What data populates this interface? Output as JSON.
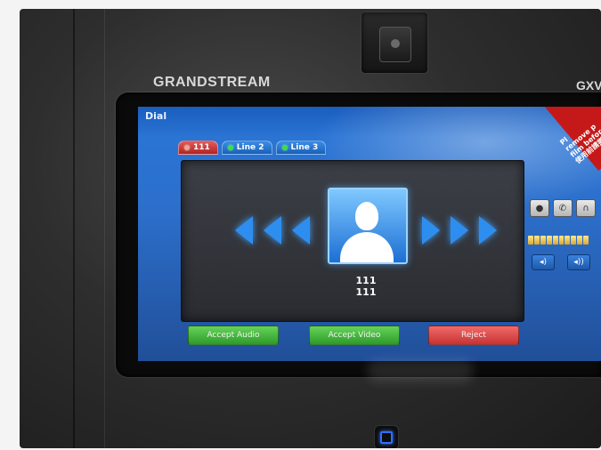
{
  "device": {
    "brand": "GRANDSTREAM",
    "model_partial": "GXV"
  },
  "screen": {
    "title": "Dial",
    "tabs": [
      {
        "label": "111",
        "active": true
      },
      {
        "label": "Line 2",
        "active": false
      },
      {
        "label": "Line 3",
        "active": false
      }
    ],
    "caller": {
      "name": "111",
      "number": "111"
    },
    "buttons": {
      "accept_audio": "Accept Audio",
      "accept_video": "Accept Video",
      "reject": "Reject"
    },
    "sticker_lines": [
      "Pl",
      "remove p",
      "film before",
      "使用前請撕保"
    ],
    "colors": {
      "accept": "#3cb33a",
      "reject": "#d84040",
      "screen_blue": "#2a6fcf"
    }
  }
}
